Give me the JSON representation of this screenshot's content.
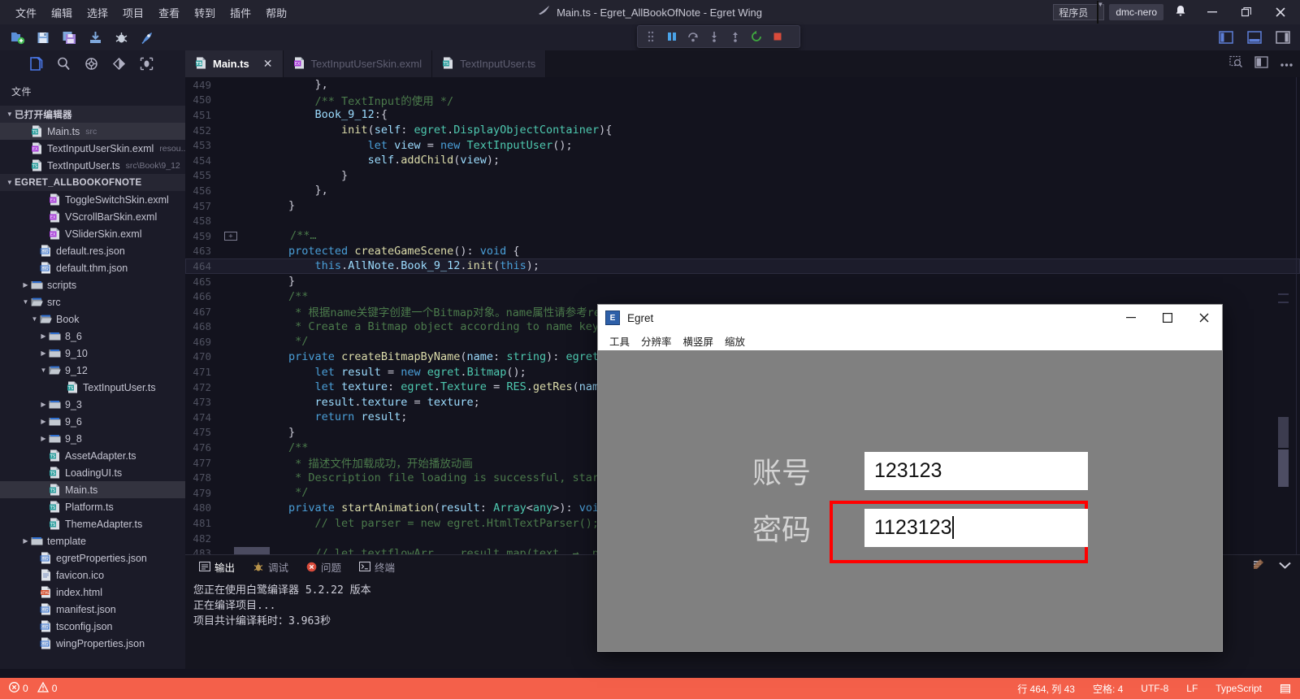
{
  "window": {
    "title": "Main.ts - Egret_AllBookOfNote - Egret Wing",
    "menus": [
      "文件",
      "编辑",
      "选择",
      "项目",
      "查看",
      "转到",
      "插件",
      "帮助"
    ],
    "role_select": "程序员",
    "user": "dmc-nero",
    "minimize": "—",
    "maximize": "❐",
    "close": "✕"
  },
  "toolbar": {
    "icons": [
      "new-file-icon",
      "save-icon",
      "save-all-icon",
      "import-icon",
      "bug-icon",
      "run-icon"
    ],
    "layout_icons": [
      "panel-left-icon",
      "panel-bottom-icon",
      "panel-right-icon"
    ]
  },
  "debugbar": {
    "icons": [
      "drag-handle-icon",
      "pause-icon",
      "step-over-icon",
      "step-into-icon",
      "step-out-icon",
      "restart-icon",
      "stop-icon"
    ]
  },
  "activitybar": {
    "icons": [
      "explorer-icon",
      "search-icon",
      "extensions-icon",
      "source-control-icon",
      "debug-icon"
    ]
  },
  "sidebar": {
    "title": "文件",
    "sections": [
      {
        "label": "已打开编辑器",
        "expanded": true,
        "items": [
          {
            "label": "Main.ts",
            "sub": "src",
            "icon": "ts-file-icon",
            "indent": 2,
            "selected": true
          },
          {
            "label": "TextInputUserSkin.exml",
            "sub": "resou...",
            "icon": "exml-file-icon",
            "indent": 2,
            "selected": false
          },
          {
            "label": "TextInputUser.ts",
            "sub": "src\\Book\\9_12",
            "icon": "ts-file-icon",
            "indent": 2,
            "selected": false
          }
        ]
      },
      {
        "label": "EGRET_ALLBOOKOFNOTE",
        "expanded": true,
        "items": [
          {
            "label": "ToggleSwitchSkin.exml",
            "sub": "",
            "icon": "exml-file-icon",
            "indent": 4,
            "selected": false
          },
          {
            "label": "VScrollBarSkin.exml",
            "sub": "",
            "icon": "exml-file-icon",
            "indent": 4,
            "selected": false
          },
          {
            "label": "VSliderSkin.exml",
            "sub": "",
            "icon": "exml-file-icon",
            "indent": 4,
            "selected": false
          },
          {
            "label": "default.res.json",
            "sub": "",
            "icon": "json-file-icon",
            "indent": 3,
            "selected": false
          },
          {
            "label": "default.thm.json",
            "sub": "",
            "icon": "json-file-icon",
            "indent": 3,
            "selected": false
          },
          {
            "label": "scripts",
            "sub": "",
            "icon": "folder-icon",
            "indent": 2,
            "selected": false,
            "twisty": "collapsed"
          },
          {
            "label": "src",
            "sub": "",
            "icon": "folder-open-icon",
            "indent": 2,
            "selected": false,
            "twisty": "expanded"
          },
          {
            "label": "Book",
            "sub": "",
            "icon": "folder-open-icon",
            "indent": 3,
            "selected": false,
            "twisty": "expanded"
          },
          {
            "label": "8_6",
            "sub": "",
            "icon": "folder-icon",
            "indent": 4,
            "selected": false,
            "twisty": "collapsed"
          },
          {
            "label": "9_10",
            "sub": "",
            "icon": "folder-icon",
            "indent": 4,
            "selected": false,
            "twisty": "collapsed"
          },
          {
            "label": "9_12",
            "sub": "",
            "icon": "folder-open-icon",
            "indent": 4,
            "selected": false,
            "twisty": "expanded"
          },
          {
            "label": "TextInputUser.ts",
            "sub": "",
            "icon": "ts-file-icon",
            "indent": 6,
            "selected": false
          },
          {
            "label": "9_3",
            "sub": "",
            "icon": "folder-icon",
            "indent": 4,
            "selected": false,
            "twisty": "collapsed"
          },
          {
            "label": "9_6",
            "sub": "",
            "icon": "folder-icon",
            "indent": 4,
            "selected": false,
            "twisty": "collapsed"
          },
          {
            "label": "9_8",
            "sub": "",
            "icon": "folder-icon",
            "indent": 4,
            "selected": false,
            "twisty": "collapsed"
          },
          {
            "label": "AssetAdapter.ts",
            "sub": "",
            "icon": "ts-file-icon",
            "indent": 4,
            "selected": false
          },
          {
            "label": "LoadingUI.ts",
            "sub": "",
            "icon": "ts-file-icon",
            "indent": 4,
            "selected": false
          },
          {
            "label": "Main.ts",
            "sub": "",
            "icon": "ts-file-icon",
            "indent": 4,
            "selected": true
          },
          {
            "label": "Platform.ts",
            "sub": "",
            "icon": "ts-file-icon",
            "indent": 4,
            "selected": false
          },
          {
            "label": "ThemeAdapter.ts",
            "sub": "",
            "icon": "ts-file-icon",
            "indent": 4,
            "selected": false
          },
          {
            "label": "template",
            "sub": "",
            "icon": "folder-icon",
            "indent": 2,
            "selected": false,
            "twisty": "collapsed"
          },
          {
            "label": "egretProperties.json",
            "sub": "",
            "icon": "json-file-icon",
            "indent": 3,
            "selected": false
          },
          {
            "label": "favicon.ico",
            "sub": "",
            "icon": "generic-file-icon",
            "indent": 3,
            "selected": false
          },
          {
            "label": "index.html",
            "sub": "",
            "icon": "html-file-icon",
            "indent": 3,
            "selected": false
          },
          {
            "label": "manifest.json",
            "sub": "",
            "icon": "json-file-icon",
            "indent": 3,
            "selected": false
          },
          {
            "label": "tsconfig.json",
            "sub": "",
            "icon": "json-file-icon",
            "indent": 3,
            "selected": false
          },
          {
            "label": "wingProperties.json",
            "sub": "",
            "icon": "json-file-icon",
            "indent": 3,
            "selected": false
          }
        ]
      }
    ]
  },
  "tabs": [
    {
      "label": "Main.ts",
      "icon": "ts-file-icon",
      "active": true,
      "closable": true
    },
    {
      "label": "TextInputUserSkin.exml",
      "icon": "exml-file-icon",
      "active": false,
      "closable": false
    },
    {
      "label": "TextInputUser.ts",
      "icon": "ts-file-icon",
      "active": false,
      "closable": false
    }
  ],
  "tabs_right_icons": [
    "split-preview-icon",
    "split-editor-icon",
    "more-actions-icon"
  ],
  "editor": {
    "lines": [
      {
        "num": "449",
        "text": "            },",
        "fold": ""
      },
      {
        "num": "450",
        "text": "            /** TextInput的使用 */",
        "fold": ""
      },
      {
        "num": "451",
        "text": "            Book_9_12:{",
        "fold": ""
      },
      {
        "num": "452",
        "text": "                init(self: egret.DisplayObjectContainer){",
        "fold": ""
      },
      {
        "num": "453",
        "text": "                    let view = new TextInputUser();",
        "fold": ""
      },
      {
        "num": "454",
        "text": "                    self.addChild(view);",
        "fold": ""
      },
      {
        "num": "455",
        "text": "                }",
        "fold": ""
      },
      {
        "num": "456",
        "text": "            },",
        "fold": ""
      },
      {
        "num": "457",
        "text": "        }",
        "fold": ""
      },
      {
        "num": "458",
        "text": "",
        "fold": ""
      },
      {
        "num": "459",
        "text": "        /**…",
        "fold": "+"
      },
      {
        "num": "463",
        "text": "        protected createGameScene(): void {",
        "fold": ""
      },
      {
        "num": "464",
        "text": "            this.AllNote.Book_9_12.init(this);",
        "fold": "",
        "highlight": true
      },
      {
        "num": "465",
        "text": "        }",
        "fold": ""
      },
      {
        "num": "466",
        "text": "        /**",
        "fold": ""
      },
      {
        "num": "467",
        "text": "         * 根据name关键字创建一个Bitmap对象。name属性请参考resourc",
        "fold": ""
      },
      {
        "num": "468",
        "text": "         * Create a Bitmap object according to name keyword.As",
        "fold": ""
      },
      {
        "num": "469",
        "text": "         */",
        "fold": ""
      },
      {
        "num": "470",
        "text": "        private createBitmapByName(name: string): egret.Bitmap",
        "fold": ""
      },
      {
        "num": "471",
        "text": "            let result = new egret.Bitmap();",
        "fold": ""
      },
      {
        "num": "472",
        "text": "            let texture: egret.Texture = RES.getRes(name);",
        "fold": ""
      },
      {
        "num": "473",
        "text": "            result.texture = texture;",
        "fold": ""
      },
      {
        "num": "474",
        "text": "            return result;",
        "fold": ""
      },
      {
        "num": "475",
        "text": "        }",
        "fold": ""
      },
      {
        "num": "476",
        "text": "        /**",
        "fold": ""
      },
      {
        "num": "477",
        "text": "         * 描述文件加载成功，开始播放动画",
        "fold": ""
      },
      {
        "num": "478",
        "text": "         * Description file loading is successful, start to pla",
        "fold": ""
      },
      {
        "num": "479",
        "text": "         */",
        "fold": ""
      },
      {
        "num": "480",
        "text": "        private startAnimation(result: Array<any>): void {",
        "fold": ""
      },
      {
        "num": "481",
        "text": "            // let parser = new egret.HtmlTextParser();",
        "fold": ""
      },
      {
        "num": "482",
        "text": "",
        "fold": ""
      },
      {
        "num": "483",
        "text": "            // let textflowArr    result.map(text  →  parser.par",
        "fold": ""
      }
    ]
  },
  "panel": {
    "tabs": [
      {
        "label": "输出",
        "icon": "output-icon",
        "active": true
      },
      {
        "label": "调试",
        "icon": "debug-icon",
        "active": false
      },
      {
        "label": "问题",
        "icon": "problems-icon",
        "active": false
      },
      {
        "label": "终端",
        "icon": "terminal-icon",
        "active": false
      }
    ],
    "right_icons": [
      "clear-output-icon",
      "collapse-panel-icon"
    ],
    "output_lines": [
      "您正在使用白鹭编译器 5.2.22 版本",
      "正在编译项目...",
      "项目共计编译耗时：3.963秒"
    ]
  },
  "statusbar": {
    "errors": "0",
    "warnings": "0",
    "error_icon": "error-circle-icon",
    "warning_icon": "warning-triangle-icon",
    "position": "行 464, 列 43",
    "indent": "空格: 4",
    "encoding": "UTF-8",
    "eol": "LF",
    "language": "TypeScript",
    "bell_icon": "feedback-icon",
    "accent_color": "#f4604a"
  },
  "egret_dialog": {
    "title": "Egret",
    "icon": "egret-app-icon",
    "menus": [
      "工具",
      "分辨率",
      "横竖屏",
      "缩放"
    ],
    "minimize": "—",
    "maximize": "☐",
    "close": "✕",
    "stage_bg": "#808080",
    "fields": [
      {
        "label": "账号",
        "value": "123123",
        "focused": false
      },
      {
        "label": "密码",
        "value": "1123123",
        "focused": true
      }
    ],
    "focus_color": "#ff0000"
  }
}
